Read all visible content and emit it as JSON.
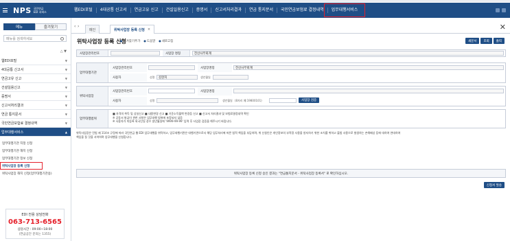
{
  "header": {
    "logo_main": "NPS",
    "logo_sub_1": "국민연금",
    "logo_sub_2": "EDI 서비스",
    "nav": [
      {
        "label": "웹EDI포털"
      },
      {
        "label": "4대공통 신고서"
      },
      {
        "label": "연금고유 신고"
      },
      {
        "label": "건설일용신고"
      },
      {
        "label": "증명서"
      },
      {
        "label": "신고서처리결과"
      },
      {
        "label": "연금 통지문서"
      },
      {
        "label": "국민연금보험료 결정내역"
      },
      {
        "label": "업무대행서비스"
      }
    ]
  },
  "sidebar": {
    "tab_menu": "메뉴",
    "tab_favorites": "즐겨찾기",
    "search_placeholder": "메뉴를 검색하세요",
    "tools": "△ ▼",
    "items": [
      {
        "label": "웹EDI포털"
      },
      {
        "label": "4대공통 신고서"
      },
      {
        "label": "연금고유 신고"
      },
      {
        "label": "건설일용신고"
      },
      {
        "label": "증명서"
      },
      {
        "label": "신고서처리결과"
      },
      {
        "label": "연금 통지문서"
      },
      {
        "label": "국민연금보험료 결정내역"
      },
      {
        "label": "업무대행서비스"
      }
    ],
    "subitems": [
      {
        "label": "업무대행기관 지정 신청"
      },
      {
        "label": "업무대행기관 해지 신청"
      },
      {
        "label": "업무대행기관 정보 신청"
      },
      {
        "label": "위탁사업장 등록 신청"
      },
      {
        "label": "위탁사업장 해지 신청(업무대행기관용)"
      }
    ],
    "contact": {
      "title": "EDI 전용 상담전화",
      "phone": "063-713-6565",
      "hours": "상담시간 : 09:00~18:00",
      "alt": "(연금공단 문의는 1355)"
    }
  },
  "tabs": {
    "home": "메인",
    "current": "위탁사업장 등록 신청",
    "close_x": "×"
  },
  "page": {
    "title": "위탁사업장 등록 신청",
    "links": [
      "즐겨찾기추가",
      "도움말",
      "새로고침"
    ],
    "buttons": {
      "new": "새문서",
      "search": "조회",
      "print": "출력"
    }
  },
  "form": {
    "row1": {
      "label_no": "사업장관리번호",
      "label_name": "사업장 명칭",
      "name_value": "전산사무회계"
    },
    "agency": {
      "label": "업무대행기관",
      "sub_no": "사업장관리번호",
      "sub_name": "사업장명칭",
      "name_value": "전산사무회계",
      "sub_user": "사용자",
      "name_label": "성명",
      "user_name": "김현지",
      "birth_label": "생년월일"
    },
    "entrusted": {
      "label": "위탁사업장",
      "sub_no": "사업장관리번호",
      "sub_name": "사업장명칭",
      "sub_user": "사용자",
      "name_label": "성명",
      "birth_label": "생년월일",
      "birth_hint": "(8자리 예:19800101)",
      "verify_btn": "사업장 검증"
    },
    "scope": {
      "label": "업무대행범위",
      "line1": "■ 자격의 취득 및 상실신고  ■ 내용변경 신고  ■ 기준소득월액 변경등 신고  ■ 신고서 처리결과 및 보험료결정내역 확인",
      "line2": "※ 공동서 발급이 관한 사항은 업무대행 범위에 포함되지 않음",
      "line3": "※ 사용자가 미등록 외국인일 경우 생년월일에 '9999-99-99' 입력 후 사업장 검증을 해주시기 바랍니다."
    }
  },
  "notes": {
    "line1": "위탁사업장은 민법 제 114조 규정에 따라 국민연금 웹 EDI 업무대행을 위탁하고, 업무대행기관은 대행기관으로서 해당 업무처리에 따른 법적 책임을 부담하며, 위 신청인은 개인정보의 부적정 사용을 방지하기 위한 조치를 취하고 불법 사용으로 발생하는 손해배상 등에 대하여 연대하여",
    "line2": "책임을 질 것을 서약하며 업무대행을 신청합니다."
  },
  "info": {
    "message": "위탁사업장 등록 신청 승인 결과는 \"연금통지문서 - 위탁사업장 등록서\" 로 확인하십시오."
  },
  "submit_btn": "신청서 발송"
}
